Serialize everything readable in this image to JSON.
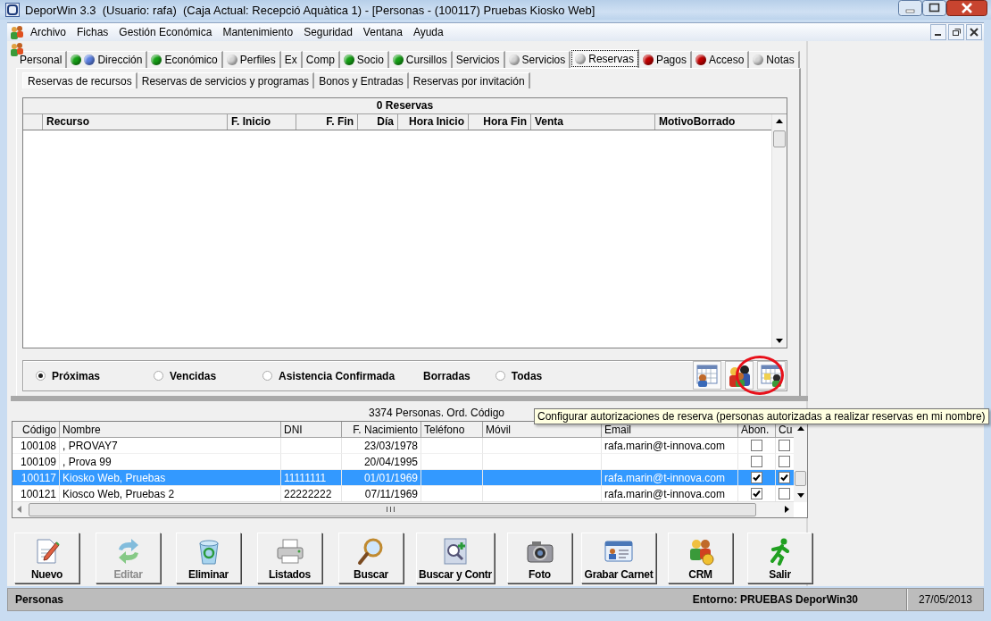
{
  "window": {
    "title": "DeporWin 3.3  (Usuario: rafa)  (Caja Actual: Recepció Aquàtica 1) - [Personas - (100117) Pruebas Kiosko Web]"
  },
  "menu": [
    "Archivo",
    "Fichas",
    "Gestión Económica",
    "Mantenimiento",
    "Seguridad",
    "Ventana",
    "Ayuda"
  ],
  "tabs": [
    {
      "label": "Personal",
      "selected": false
    },
    {
      "label": "Dirección",
      "selected": false,
      "lights": [
        {
          "color": "#16a016"
        },
        {
          "color": "#5b7fe0"
        }
      ]
    },
    {
      "label": "Económico",
      "selected": false,
      "lights": [
        {
          "color": "#16a016"
        }
      ]
    },
    {
      "label": "Perfiles",
      "selected": false,
      "lights": [
        {
          "color": "#d4d4d4"
        }
      ]
    },
    {
      "label": "Ex",
      "selected": false
    },
    {
      "label": "Comp",
      "selected": false
    },
    {
      "label": "Socio",
      "selected": false,
      "lights": [
        {
          "color": "#16a016"
        }
      ]
    },
    {
      "label": "Cursillos",
      "selected": false,
      "lights": [
        {
          "color": "#16a016"
        }
      ]
    },
    {
      "label": "Servicios",
      "selected": false
    },
    {
      "label": "Servicios",
      "selected": false,
      "lights": [
        {
          "color": "#d4d4d4"
        }
      ]
    },
    {
      "label": "Reservas",
      "selected": true,
      "lights": [
        {
          "color": "#d4d4d4"
        }
      ]
    },
    {
      "label": "Pagos",
      "selected": false,
      "lights": [
        {
          "color": "#c00000"
        }
      ]
    },
    {
      "label": "Acceso",
      "selected": false,
      "lights": [
        {
          "color": "#c00000"
        }
      ]
    },
    {
      "label": "Notas",
      "selected": false,
      "lights": [
        {
          "color": "#d4d4d4"
        }
      ]
    }
  ],
  "sub_tabs": [
    {
      "label": "Reservas de recursos",
      "selected": true
    },
    {
      "label": "Reservas de servicios y programas",
      "selected": false
    },
    {
      "label": "Bonos y Entradas",
      "selected": false
    },
    {
      "label": "Reservas por invitación",
      "selected": false
    }
  ],
  "reservations": {
    "caption": "0 Reservas",
    "columns": [
      "Recurso",
      "F. Inicio",
      "F. Fin",
      "Día",
      "Hora Inicio",
      "Hora Fin",
      "Venta",
      "MotivoBorrado"
    ],
    "filters": [
      {
        "kind": "radio",
        "label": "Próximas",
        "selected": true
      },
      {
        "kind": "radio",
        "label": "Vencidas",
        "selected": false
      },
      {
        "kind": "radio",
        "label": "Asistencia Confirmada",
        "selected": false
      },
      {
        "kind": "label",
        "label": "Borradas"
      },
      {
        "kind": "radio",
        "label": "Todas",
        "selected": false
      }
    ]
  },
  "persons": {
    "caption": "3374 Personas. Ord. Código",
    "columns": [
      "Código",
      "Nombre",
      "DNI",
      "F. Nacimiento",
      "Teléfono",
      "Móvil",
      "Email",
      "Abon.",
      "Cu"
    ],
    "rows": [
      {
        "selected": false,
        "code": "100108",
        "name": ", PROVAY7",
        "birth_date": "23/03/1978",
        "email": "rafa.marin@t-innova.com",
        "abon": false,
        "cu": false
      },
      {
        "selected": false,
        "code": "100109",
        "name": ", Prova 99",
        "birth_date": "20/04/1995",
        "abon": false,
        "cu": false
      },
      {
        "selected": true,
        "code": "100117",
        "name": "Kiosko Web, Pruebas",
        "dni": "11111111",
        "birth_date": "01/01/1969",
        "email": "rafa.marin@t-innova.com",
        "abon": true,
        "cu": true
      },
      {
        "selected": false,
        "code": "100121",
        "name": "Kiosco Web, Pruebas 2",
        "dni": "22222222",
        "birth_date": "07/11/1969",
        "email": "rafa.marin@t-innova.com",
        "abon": true,
        "cu": false
      }
    ]
  },
  "tooltip": "Configurar autorizaciones de reserva (personas autorizadas a realizar reservas en mi nombre)",
  "toolbar": [
    {
      "label": "Nuevo",
      "disabled": false
    },
    {
      "label": "Editar",
      "disabled": true
    },
    {
      "label": "Eliminar",
      "disabled": false
    },
    {
      "label": "Listados",
      "disabled": false
    },
    {
      "label": "Buscar",
      "disabled": false
    },
    {
      "label": "Buscar y Contr",
      "disabled": false
    },
    {
      "label": "Foto",
      "disabled": false
    },
    {
      "label": "Grabar Carnet",
      "disabled": false
    },
    {
      "label": "CRM",
      "disabled": false
    },
    {
      "label": "Salir",
      "disabled": false
    }
  ],
  "status_bar": {
    "section": "Personas",
    "environment": "Entorno: PRUEBAS DeporWin30",
    "date": "27/05/2013"
  }
}
